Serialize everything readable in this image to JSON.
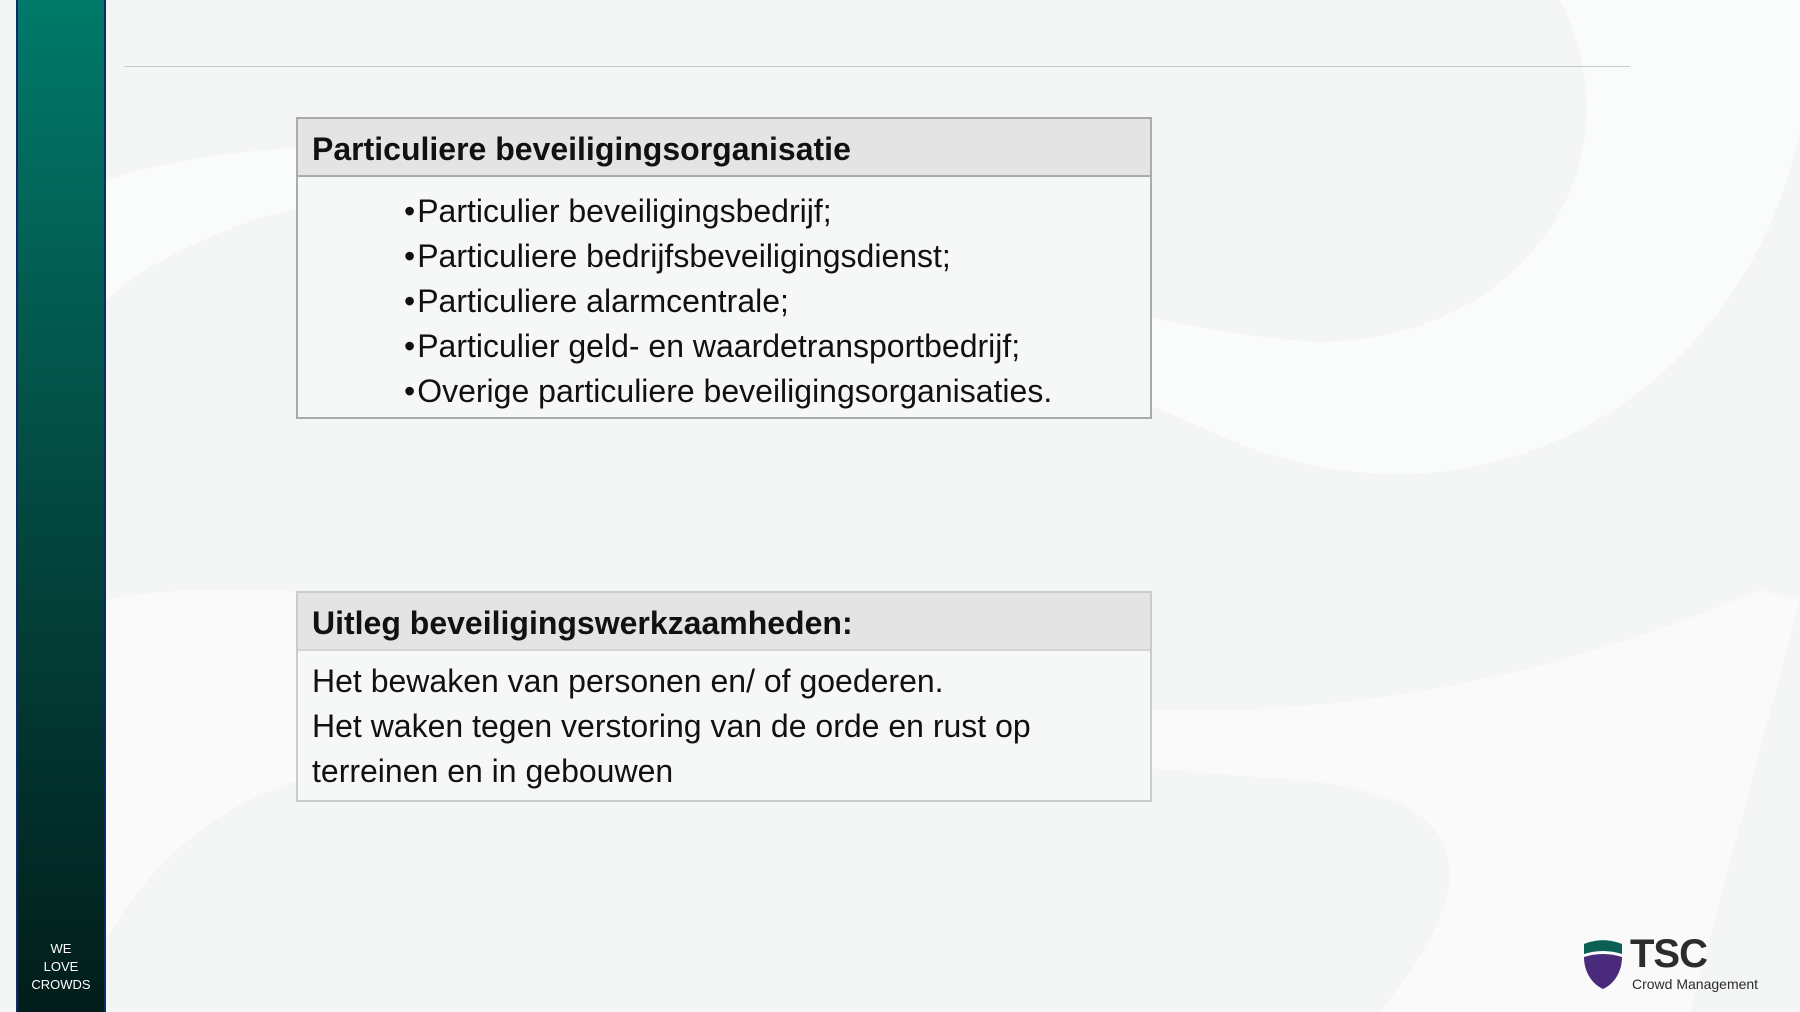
{
  "sidebar": {
    "tagline": [
      "WE",
      "LOVE",
      "CROWDS"
    ]
  },
  "box1": {
    "title": "Particuliere beveiligingsorganisatie",
    "items": [
      "Particulier beveiligingsbedrijf;",
      "Particuliere bedrijfsbeveiligingsdienst;",
      "Particuliere alarmcentrale;",
      "Particulier geld- en waardetransportbedrijf;",
      "Overige particuliere beveiligingsorganisaties."
    ],
    "bullet": "•"
  },
  "box2": {
    "title": "Uitleg beveiligingswerkzaamheden:",
    "lines": [
      "Het bewaken van personen en/ of goederen.",
      "Het waken tegen verstoring van de orde en rust op terreinen en in gebouwen"
    ]
  },
  "logo": {
    "name": "TSC",
    "subtitle": "Crowd Management",
    "icon": "shield-icon"
  },
  "colors": {
    "sidebar_top": "#007a6a",
    "sidebar_bottom": "#021d1b",
    "header_fill": "#e4e4e5",
    "logo_teal": "#0b5f55",
    "logo_purple": "#4a2a7a"
  }
}
